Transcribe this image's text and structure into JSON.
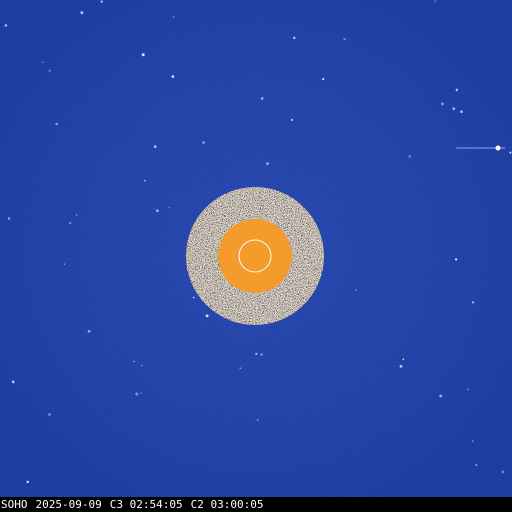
{
  "image": {
    "instrument_overlay": {
      "observatory": "SOHO",
      "date": "2025-09-09",
      "c3_time": "C3 02:54:05",
      "c2_time": "C2 03:00:05"
    },
    "colors": {
      "background_blue": "#1a3aa6",
      "occulter_orange": "#f39b2b",
      "sun_outline": "#ffffff",
      "c2_ring_light": "#efe6d6",
      "c2_ring_dark": "#3a2a1f"
    }
  }
}
